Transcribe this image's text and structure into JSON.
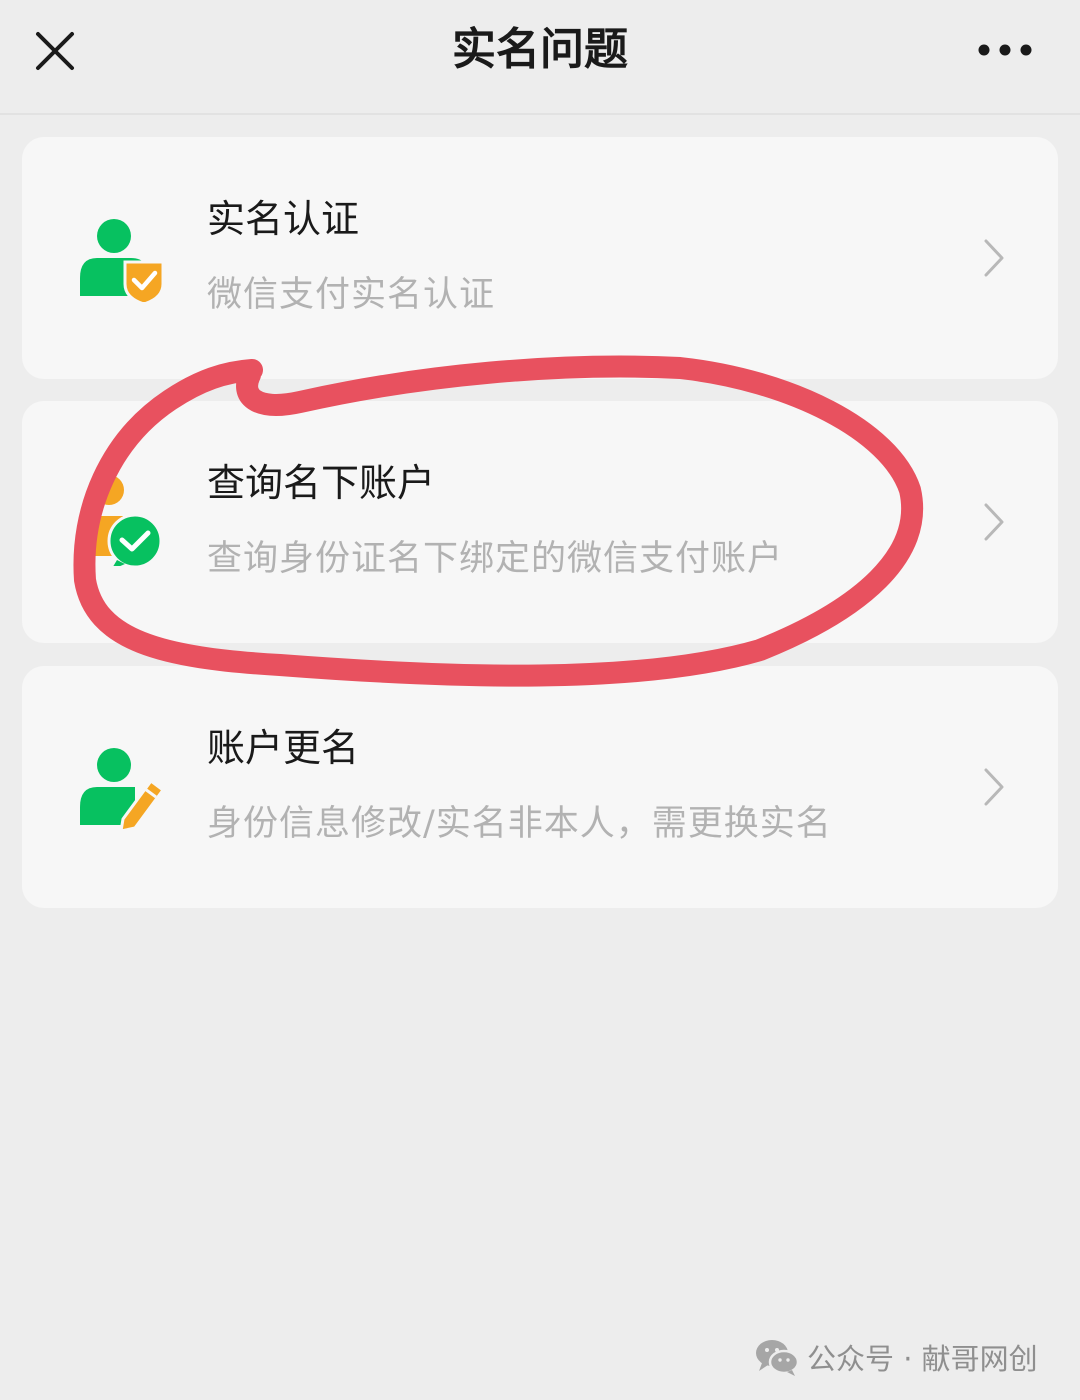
{
  "header": {
    "title": "实名问题",
    "close_icon": "close-icon",
    "more_icon": "more-icon"
  },
  "items": [
    {
      "title": "实名认证",
      "desc": "微信支付实名认证",
      "icon": "user-shield-icon"
    },
    {
      "title": "查询名下账户",
      "desc": "查询身份证名下绑定的微信支付账户",
      "icon": "user-wechat-pay-icon"
    },
    {
      "title": "账户更名",
      "desc": "身份信息修改/实名非本人，需更换实名",
      "icon": "user-edit-icon"
    }
  ],
  "watermark": {
    "text": "公众号 · 献哥网创",
    "icon": "wechat-icon"
  },
  "colors": {
    "accent_green": "#07c160",
    "accent_orange": "#f5a623",
    "annotation_red": "#e8515f",
    "background": "#ededed",
    "card": "#f7f7f7"
  }
}
